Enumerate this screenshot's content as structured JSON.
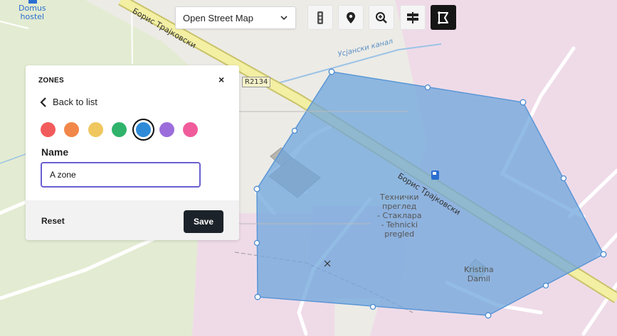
{
  "map": {
    "poi_hostel": "Domus\nhostel",
    "road_upper": "Борис Трајковски",
    "road_lower": "Борис Трајковски",
    "canal": "Усјански канал",
    "route_shield": "R2134",
    "poi_inspection": "Технички\nпреглед\n- Стаклара\n- Tehnicki\npregled",
    "poi_kristina": "Kristina\nDamil"
  },
  "toolbar": {
    "layer_select_value": "Open Street Map",
    "buttons": [
      "traffic-light-icon",
      "map-pin-icon",
      "zoom-icon",
      "signpost-icon",
      "polygon-draw-icon"
    ]
  },
  "panel": {
    "title": "ZONES",
    "close": "×",
    "back_label": "Back to list",
    "colors": [
      "#f25b5b",
      "#f2874a",
      "#f0c75e",
      "#2fb36b",
      "#2f8bd8",
      "#9b6ddb",
      "#f05c9b"
    ],
    "selected_color": "#2f8bd8",
    "name_label": "Name",
    "name_value": "A zone",
    "reset_label": "Reset",
    "save_label": "Save"
  }
}
